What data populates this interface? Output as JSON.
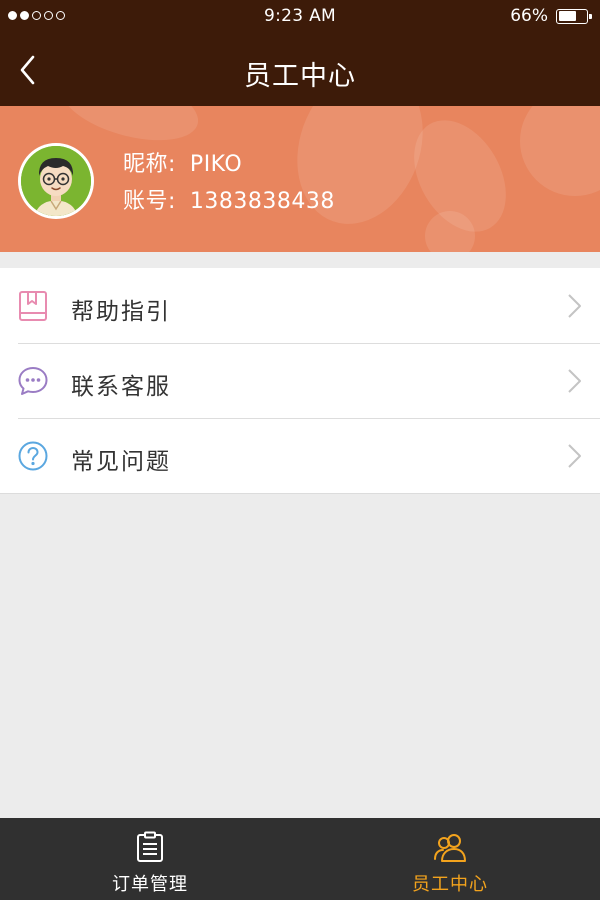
{
  "status_bar": {
    "time": "9:23 AM",
    "battery_percent": "66%",
    "battery_level": 0.66,
    "signal_bars_filled": 2,
    "signal_bars_total": 5
  },
  "nav": {
    "title": "员工中心",
    "back_icon": "chevron-left-icon"
  },
  "profile": {
    "nickname_label": "昵称:",
    "nickname": "PIKO",
    "account_label": "账号:",
    "account": "1383838438"
  },
  "menu": [
    {
      "label": "帮助指引",
      "icon": "book-icon",
      "icon_color": "#e88bb0"
    },
    {
      "label": "联系客服",
      "icon": "chat-bubble-icon",
      "icon_color": "#9a7cc4"
    },
    {
      "label": "常见问题",
      "icon": "question-circle-icon",
      "icon_color": "#5aa7e0"
    }
  ],
  "tabs": [
    {
      "label": "订单管理",
      "icon": "clipboard-icon",
      "active": false
    },
    {
      "label": "员工中心",
      "icon": "users-icon",
      "active": true
    }
  ],
  "colors": {
    "header_bg": "#3d1b09",
    "banner_bg": "#e8855e",
    "tabbar_bg": "#303030",
    "active_tab": "#f3a31d",
    "page_bg": "#ececec"
  }
}
